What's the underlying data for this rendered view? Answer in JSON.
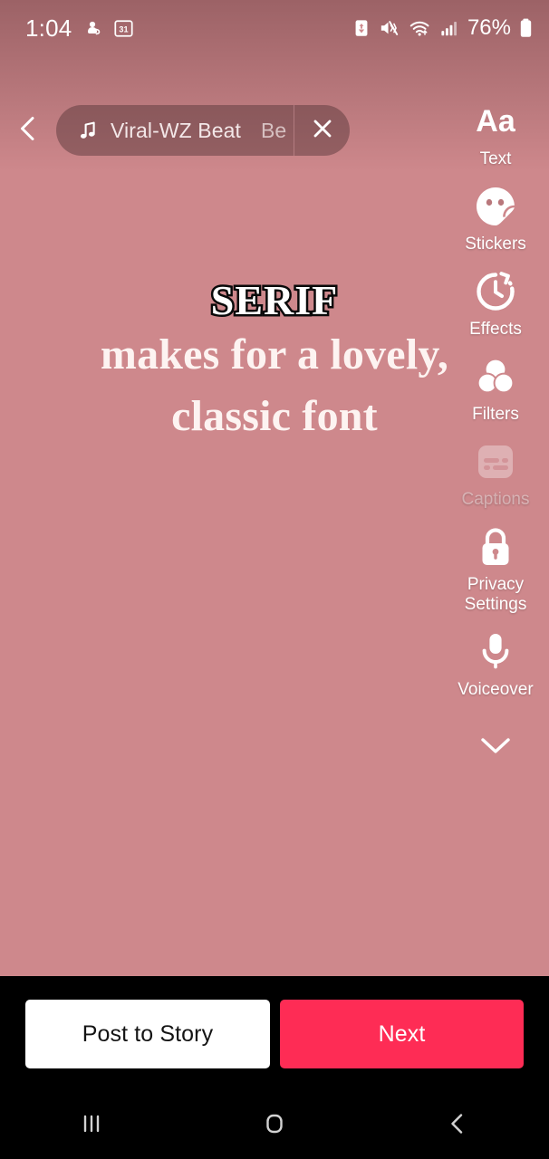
{
  "status_bar": {
    "time": "1:04",
    "battery_percent": "76%",
    "icons": [
      "app-notification-icon",
      "calendar-31-icon",
      "battery-saver-icon",
      "mute-vibrate-icon",
      "wifi-icon",
      "cellular-signal-icon",
      "battery-icon"
    ]
  },
  "top_bar": {
    "back_icon": "chevron-left-icon",
    "music": {
      "note_icon": "music-note-icon",
      "title": "Viral-WZ Beat",
      "marquee_tail": "Be",
      "close_icon": "close-x-icon"
    }
  },
  "tool_rail": {
    "items": [
      {
        "id": "text",
        "label": "Text",
        "icon": "text-aa-icon",
        "disabled": false
      },
      {
        "id": "stickers",
        "label": "Stickers",
        "icon": "sticker-face-icon",
        "disabled": false
      },
      {
        "id": "effects",
        "label": "Effects",
        "icon": "clock-effects-icon",
        "disabled": false
      },
      {
        "id": "filters",
        "label": "Filters",
        "icon": "filters-circles-icon",
        "disabled": false
      },
      {
        "id": "captions",
        "label": "Captions",
        "icon": "captions-icon",
        "disabled": true
      },
      {
        "id": "privacy",
        "label": "Privacy\nSettings",
        "icon": "lock-icon",
        "disabled": false
      },
      {
        "id": "voiceover",
        "label": "Voiceover",
        "icon": "microphone-icon",
        "disabled": false
      }
    ],
    "collapse_icon": "chevron-down-icon"
  },
  "overlay_text": {
    "line1": "SERIF",
    "line2": "makes for a lovely,",
    "line3": "classic font"
  },
  "action_bar": {
    "post_to_story": "Post to Story",
    "next": "Next"
  },
  "nav_bar": {
    "recents": "recents-icon",
    "home": "home-icon",
    "back": "back-icon"
  },
  "colors": {
    "canvas_background": "#ce888c",
    "next_button": "#fe2c55",
    "post_button": "#ffffff",
    "bar_background": "#000000",
    "music_pill": "rgba(72,42,46,0.42)"
  }
}
